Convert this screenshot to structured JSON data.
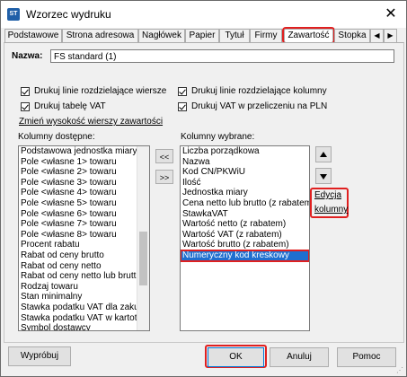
{
  "window": {
    "title": "Wzorzec wydruku",
    "icon": "window-app-icon",
    "close_label": "✕"
  },
  "tabs": [
    {
      "label": "Podstawowe"
    },
    {
      "label": "Strona adresowa"
    },
    {
      "label": "Nagłówek"
    },
    {
      "label": "Papier"
    },
    {
      "label": "Tytuł"
    },
    {
      "label": "Firmy"
    },
    {
      "label": "Zawartość",
      "active": true
    },
    {
      "label": "Stopka"
    }
  ],
  "tab_arrows": {
    "left": "◀",
    "right": "▶"
  },
  "name": {
    "label": "Nazwa:",
    "value": "FS standard (1)"
  },
  "checkboxes": [
    {
      "label": "Drukuj linie rozdzielające wiersze",
      "checked": true
    },
    {
      "label": "Drukuj linie rozdzielające kolumny",
      "checked": true
    },
    {
      "label": "Drukuj tabelę VAT",
      "checked": true
    },
    {
      "label": "Drukuj VAT w przeliczeniu na PLN",
      "checked": true
    }
  ],
  "change_row_height_link": "Zmień wysokość wierszy zawartości",
  "available": {
    "label": "Kolumny dostępne:",
    "items": [
      "Podstawowa jednostka miary",
      "Pole <własne 1> towaru",
      "Pole <własne 2> towaru",
      "Pole <własne 3> towaru",
      "Pole <własne 4> towaru",
      "Pole <własne 5> towaru",
      "Pole <własne 6> towaru",
      "Pole <własne 7> towaru",
      "Pole <własne 8> towaru",
      "Procent rabatu",
      "Rabat od ceny brutto",
      "Rabat od ceny netto",
      "Rabat od ceny netto lub brutt",
      "Rodzaj towaru",
      "Stan minimalny",
      "Stawka podatku VAT dla zaku",
      "Stawka podatku VAT w kartot",
      "Symbol dostawcy"
    ]
  },
  "move_buttons": {
    "remove": "<<",
    "add": ">>"
  },
  "selected": {
    "label": "Kolumny wybrane:",
    "items": [
      "Liczba porządkowa",
      "Nazwa",
      "Kod CN/PKWiU",
      "Ilość",
      "Jednostka miary",
      "Cena netto lub brutto (z rabatem",
      "StawkaVAT",
      "Wartość netto (z rabatem)",
      "Wartość VAT (z rabatem)",
      "Wartość brutto (z rabatem)",
      "Numeryczny kod kreskowy"
    ],
    "selected_index": 10
  },
  "edit_columns_link": {
    "line1": "Edycja",
    "line2": "kolumny"
  },
  "buttons": {
    "preview": "Wypróbuj",
    "ok": "OK",
    "cancel": "Anuluj",
    "help": "Pomoc"
  },
  "colors": {
    "highlight": "#e02020",
    "selection": "#1f6fd0"
  }
}
